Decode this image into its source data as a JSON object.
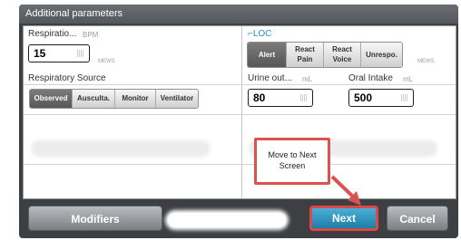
{
  "window": {
    "title": "Additional parameters"
  },
  "respiration": {
    "label": "Respiratio...",
    "unit": "BPM",
    "value": "15",
    "score_tag": "MEWS"
  },
  "loc": {
    "label": "LOC",
    "options": [
      {
        "line1": "Alert",
        "line2": ""
      },
      {
        "line1": "React",
        "line2": "Pain"
      },
      {
        "line1": "React",
        "line2": "Voice"
      },
      {
        "line1": "Unrespo.",
        "line2": ""
      }
    ],
    "selected": "Alert",
    "score_tag": "MEWS"
  },
  "respiratory_source": {
    "label": "Respiratory Source",
    "options": [
      "Observed",
      "Ausculta.",
      "Monitor",
      "Ventilator"
    ],
    "selected": "Observed"
  },
  "urine_output": {
    "label": "Urine out...",
    "unit": "mL",
    "value": "80"
  },
  "oral_intake": {
    "label": "Oral Intake",
    "unit": "mL",
    "value": "500"
  },
  "buttons": {
    "modifiers": "Modifiers",
    "next": "Next",
    "cancel": "Cancel"
  },
  "annotation": {
    "text_line1": "Move to Next",
    "text_line2": "Screen",
    "color": "#d9534f"
  },
  "colors": {
    "accent": "#2a8fbf",
    "selected": "#626262",
    "highlight": "#d94a4a"
  }
}
